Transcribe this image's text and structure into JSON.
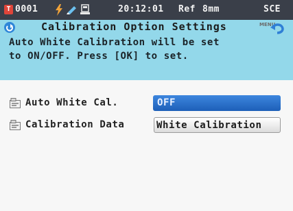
{
  "status_bar": {
    "sample_id": "0001",
    "time": "20:12:01",
    "reference": "Ref",
    "aperture": "8mm",
    "mode": "SCE"
  },
  "header": {
    "title": "Calibration Option Settings",
    "menu_label": "MENU",
    "message_line1": "Auto White Calibration will be set",
    "message_line2": "to ON/OFF. Press [OK] to set."
  },
  "settings": [
    {
      "label": "Auto White Cal.",
      "value": "OFF",
      "selected": true
    },
    {
      "label": "Calibration Data",
      "value": "White Calibration",
      "selected": false
    }
  ],
  "colors": {
    "status_bar": "#3a3f49",
    "header_bg": "#93d8ea",
    "selected_value": "#2a6fcc",
    "id_badge": "#e0453a"
  }
}
